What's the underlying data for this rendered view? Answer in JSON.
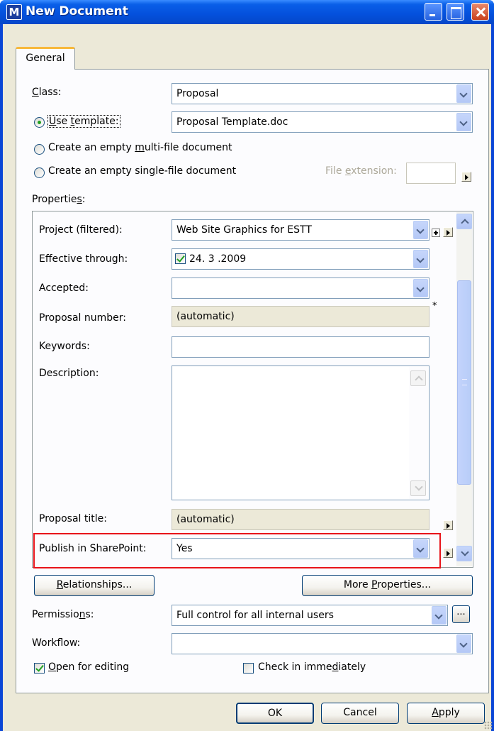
{
  "window": {
    "title": "New Document",
    "app_icon_letter": "M"
  },
  "tab": {
    "label": "General"
  },
  "class": {
    "label": "Class:",
    "value": "Proposal"
  },
  "use_template": {
    "label": "Use template:",
    "value": "Proposal Template.doc",
    "selected": true
  },
  "create_multi": {
    "label": "Create an empty multi-file document"
  },
  "create_single": {
    "label": "Create an empty single-file document"
  },
  "file_extension": {
    "label": "File extension:",
    "value": ""
  },
  "properties": {
    "label": "Properties:",
    "project": {
      "label": "Project (filtered):",
      "value": "Web Site Graphics for ESTT"
    },
    "effective_through": {
      "label": "Effective through:",
      "value": "24. 3 .2009",
      "checked": true
    },
    "accepted": {
      "label": "Accepted:",
      "value": ""
    },
    "proposal_number": {
      "label": "Proposal number:",
      "value": "(automatic)",
      "required_mark": "*"
    },
    "keywords": {
      "label": "Keywords:",
      "value": ""
    },
    "description": {
      "label": "Description:",
      "value": ""
    },
    "proposal_title": {
      "label": "Proposal title:",
      "value": "(automatic)"
    },
    "publish_sharepoint": {
      "label": "Publish in SharePoint:",
      "value": "Yes"
    }
  },
  "buttons": {
    "relationships": "Relationships...",
    "more_properties": "More Properties...",
    "ok": "OK",
    "cancel": "Cancel",
    "apply": "Apply",
    "ellipsis": "..."
  },
  "permissions": {
    "label": "Permissions:",
    "value": "Full control for all internal users"
  },
  "workflow": {
    "label": "Workflow:",
    "value": ""
  },
  "open_for_editing": {
    "label": "Open for editing",
    "checked": true
  },
  "check_in_immediately": {
    "label": "Check in immediately",
    "checked": false
  },
  "colors": {
    "title_bar": "#0450dc",
    "dialog_bg": "#ece9d8",
    "highlight_border": "#e8141a",
    "check_green": "#21a121"
  }
}
